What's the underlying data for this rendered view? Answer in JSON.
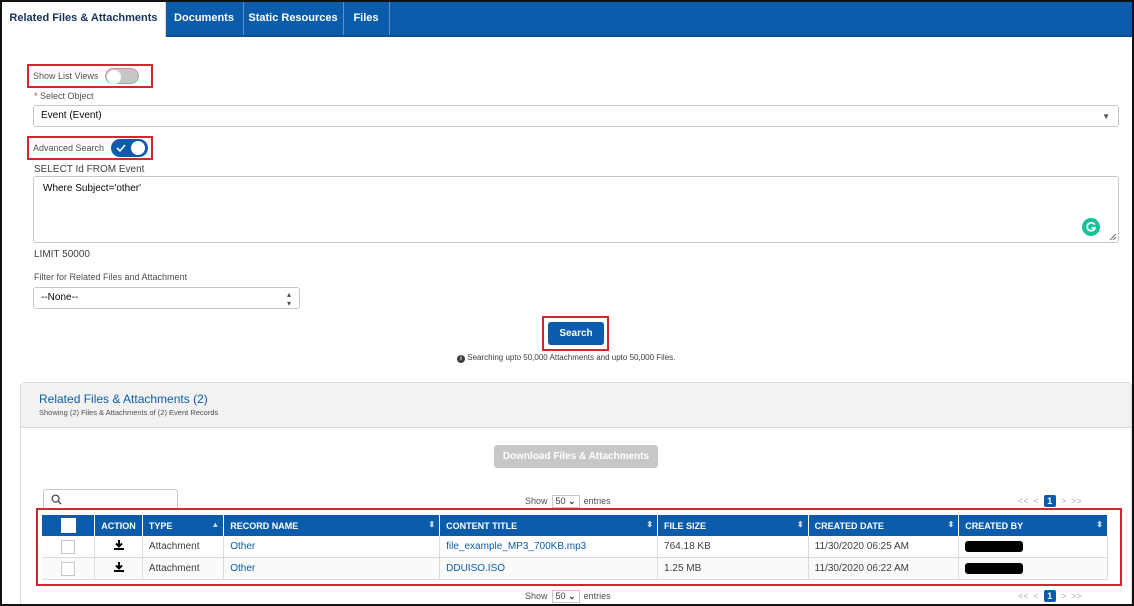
{
  "tabs": [
    {
      "label": "Related Files & Attachments",
      "active": true
    },
    {
      "label": "Documents",
      "active": false
    },
    {
      "label": "Static Resources",
      "active": false
    },
    {
      "label": "Files",
      "active": false
    }
  ],
  "form": {
    "show_list_views_label": "Show List Views",
    "show_list_views_on": false,
    "select_object_required": "*",
    "select_object_label": "Select Object",
    "select_object_value": "Event (Event)",
    "advanced_search_label": "Advanced Search",
    "advanced_search_on": true,
    "query_prefix": "SELECT Id FROM Event",
    "query_where": "Where Subject='other'",
    "query_limit": "LIMIT 50000",
    "filter_label": "Filter for Related Files and Attachment",
    "filter_value": "--None--",
    "search_button": "Search",
    "search_note": "Searching upto 50,000 Attachments and upto 50,000 Files."
  },
  "results": {
    "title": "Related Files & Attachments (2)",
    "subtitle": "Showing (2) Files & Attachments of (2) Event Records",
    "download_button": "Download Files & Attachments",
    "show_label": "Show",
    "entries_value": "50",
    "entries_label": "entries",
    "pager": {
      "first": "<<",
      "prev": "<",
      "page": "1",
      "next": ">",
      "last": ">>"
    },
    "columns": [
      "ACTION",
      "TYPE",
      "RECORD NAME",
      "CONTENT TITLE",
      "FILE SIZE",
      "CREATED DATE",
      "CREATED BY"
    ],
    "rows": [
      {
        "type": "Attachment",
        "record_name": "Other",
        "content_title": "file_example_MP3_700KB.mp3",
        "file_size": "764.18 KB",
        "created_date": "11/30/2020 06:25 AM"
      },
      {
        "type": "Attachment",
        "record_name": "Other",
        "content_title": "DDUISO.ISO",
        "file_size": "1.25 MB",
        "created_date": "11/30/2020 06:22 AM"
      }
    ]
  },
  "icons": {
    "search": "search-icon",
    "download": "download-icon",
    "grammarly": "grammarly-icon",
    "info": "info-icon"
  },
  "colors": {
    "brand": "#0b5cab",
    "highlight": "#d4262f",
    "grammarly": "#15c39a"
  }
}
